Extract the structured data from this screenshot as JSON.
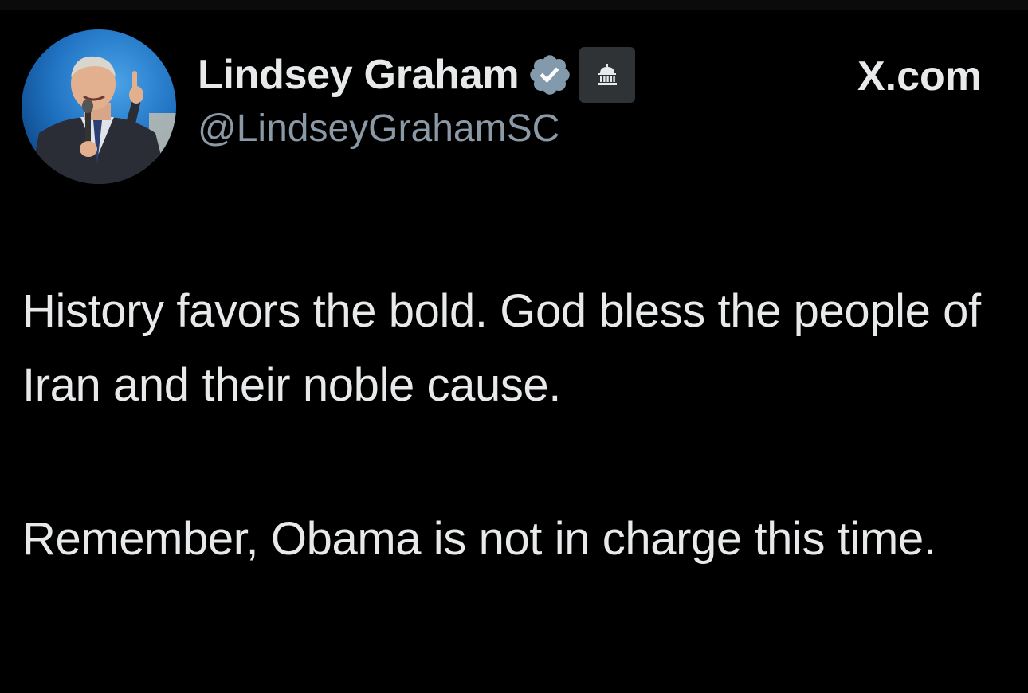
{
  "post": {
    "author": {
      "display_name": "Lindsey Graham",
      "handle": "@LindseyGrahamSC",
      "verified_icon": "verified-badge-icon",
      "affiliation_icon": "government-building-icon"
    },
    "site_label": "X.com",
    "text_paragraphs": [
      "History favors the bold. God bless the people of Iran and their noble cause.",
      "Remember, Obama is not in charge this time."
    ]
  },
  "colors": {
    "background": "#000000",
    "primary_text": "#e7e9ea",
    "secondary_text": "#8b98a5",
    "verified_badge": "#829aab",
    "gov_badge_bg": "#2f3336"
  }
}
